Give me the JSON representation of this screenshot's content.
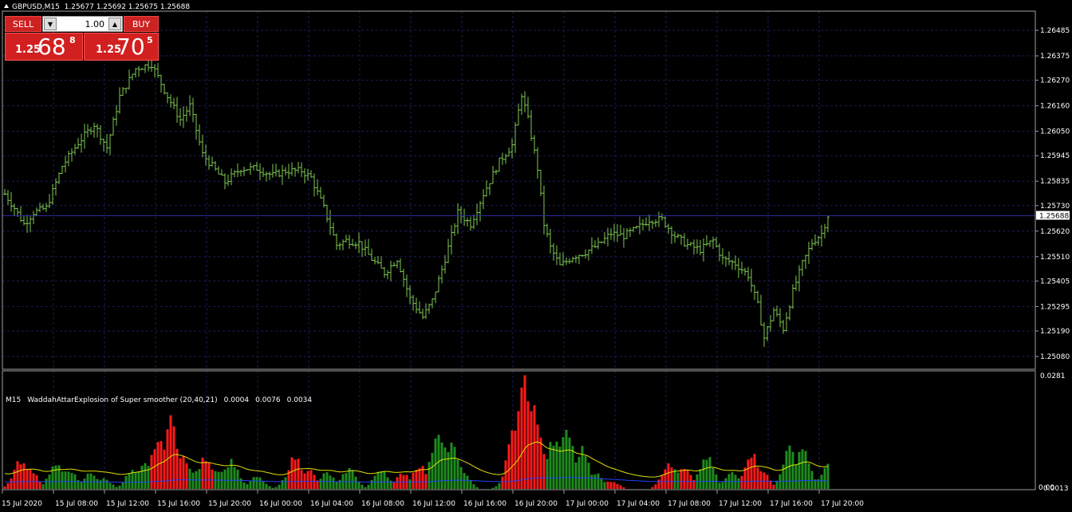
{
  "chart_header": {
    "symbol_tf": "GBPUSD,M15",
    "ohlc": "1.25677 1.25692 1.25675 1.25688"
  },
  "trade_panel": {
    "sell_label": "SELL",
    "buy_label": "BUY",
    "lot_value": "1.00",
    "sell_price_prefix": "1.25",
    "sell_price_big": "68",
    "sell_price_sup": "8",
    "buy_price_prefix": "1.25",
    "buy_price_big": "70",
    "buy_price_sup": "5"
  },
  "price_axis": {
    "labels": [
      "1.26485",
      "1.26375",
      "1.26270",
      "1.26160",
      "1.26050",
      "1.25945",
      "1.25835",
      "1.25730",
      "1.25620",
      "1.25510",
      "1.25405",
      "1.25295",
      "1.25190",
      "1.25080"
    ],
    "current_price": "1.25688"
  },
  "indicator": {
    "timeframe": "M15",
    "name": "WaddahAttarExplosion of Super smoother (20,40,21)",
    "v1": "0.0004",
    "v2": "0.0076",
    "v3": "0.0034",
    "scale_max": "0.0281",
    "scale_min_a": "0.00",
    "scale_min_b": "0.0013"
  },
  "time_axis": {
    "labels": [
      "15 Jul 2020",
      "15 Jul 08:00",
      "15 Jul 12:00",
      "15 Jul 16:00",
      "15 Jul 20:00",
      "16 Jul 00:00",
      "16 Jul 04:00",
      "16 Jul 08:00",
      "16 Jul 12:00",
      "16 Jul 16:00",
      "16 Jul 20:00",
      "17 Jul 00:00",
      "17 Jul 04:00",
      "17 Jul 08:00",
      "17 Jul 12:00",
      "17 Jul 16:00",
      "17 Jul 20:00"
    ]
  },
  "colors": {
    "background": "#000000",
    "grid": "#1c1c5a",
    "bars": "#7ec850",
    "current_price_line": "#2a2a9a",
    "hist_up": "#1e8c1e",
    "hist_down": "#ff1a1a",
    "signal_line": "#e0e000",
    "deadzone_line": "#2040ff"
  },
  "chart_data": {
    "type": "bar",
    "price_series_anchors": [
      [
        0,
        1.2578
      ],
      [
        3,
        1.2572
      ],
      [
        6,
        1.2565
      ],
      [
        9,
        1.257
      ],
      [
        13,
        1.2572
      ],
      [
        18,
        1.259
      ],
      [
        23,
        1.26
      ],
      [
        28,
        1.2608
      ],
      [
        32,
        1.2598
      ],
      [
        36,
        1.262
      ],
      [
        41,
        1.2632
      ],
      [
        46,
        1.2634
      ],
      [
        51,
        1.262
      ],
      [
        55,
        1.261
      ],
      [
        58,
        1.2616
      ],
      [
        62,
        1.2595
      ],
      [
        65,
        1.259
      ],
      [
        69,
        1.2583
      ],
      [
        74,
        1.2589
      ],
      [
        79,
        1.2589
      ],
      [
        84,
        1.2586
      ],
      [
        88,
        1.2588
      ],
      [
        93,
        1.2588
      ],
      [
        96,
        1.2585
      ],
      [
        100,
        1.2572
      ],
      [
        104,
        1.2556
      ],
      [
        107,
        1.2558
      ],
      [
        111,
        1.2557
      ],
      [
        115,
        1.255
      ],
      [
        119,
        1.2544
      ],
      [
        123,
        1.255
      ],
      [
        127,
        1.2533
      ],
      [
        131,
        1.2525
      ],
      [
        134,
        1.2532
      ],
      [
        138,
        1.255
      ],
      [
        142,
        1.257
      ],
      [
        146,
        1.2565
      ],
      [
        150,
        1.2578
      ],
      [
        155,
        1.2592
      ],
      [
        159,
        1.2599
      ],
      [
        162,
        1.2621
      ],
      [
        164,
        1.261
      ],
      [
        167,
        1.2589
      ],
      [
        169,
        1.2565
      ],
      [
        171,
        1.2555
      ],
      [
        174,
        1.2547
      ],
      [
        178,
        1.2551
      ],
      [
        182,
        1.2553
      ],
      [
        186,
        1.2556
      ],
      [
        190,
        1.2561
      ],
      [
        194,
        1.256
      ],
      [
        198,
        1.2563
      ],
      [
        202,
        1.2567
      ],
      [
        206,
        1.2567
      ],
      [
        210,
        1.256
      ],
      [
        214,
        1.2556
      ],
      [
        218,
        1.2554
      ],
      [
        222,
        1.2558
      ],
      [
        225,
        1.255
      ],
      [
        229,
        1.2548
      ],
      [
        233,
        1.2543
      ],
      [
        236,
        1.253
      ],
      [
        238,
        1.2516
      ],
      [
        241,
        1.2528
      ],
      [
        244,
        1.252
      ],
      [
        247,
        1.2536
      ],
      [
        250,
        1.2548
      ],
      [
        253,
        1.2557
      ],
      [
        256,
        1.2561
      ],
      [
        258,
        1.25688
      ]
    ],
    "price_ylim": [
      1.2508,
      1.2654
    ],
    "current_price": 1.25688,
    "histogram_anchors_up": [
      [
        16,
        0.006
      ],
      [
        20,
        0.005
      ],
      [
        27,
        0.004
      ],
      [
        31,
        0.0025
      ],
      [
        40,
        0.0045
      ],
      [
        44,
        0.006
      ],
      [
        49,
        0.0035
      ],
      [
        58,
        0.005
      ],
      [
        62,
        0.006
      ],
      [
        67,
        0.005
      ],
      [
        71,
        0.007
      ],
      [
        79,
        0.003
      ],
      [
        90,
        0.005
      ],
      [
        101,
        0.004
      ],
      [
        108,
        0.005
      ],
      [
        118,
        0.005
      ],
      [
        129,
        0.004
      ],
      [
        136,
        0.015
      ],
      [
        140,
        0.011
      ],
      [
        143,
        0.005
      ],
      [
        158,
        0.0035
      ],
      [
        172,
        0.012
      ],
      [
        176,
        0.015
      ],
      [
        181,
        0.01
      ],
      [
        185,
        0.004
      ],
      [
        210,
        0.005
      ],
      [
        220,
        0.008
      ],
      [
        228,
        0.004
      ],
      [
        246,
        0.01
      ],
      [
        250,
        0.0105
      ],
      [
        258,
        0.006
      ]
    ],
    "histogram_anchors_down": [
      [
        5,
        0.007
      ],
      [
        8,
        0.005
      ],
      [
        48,
        0.012
      ],
      [
        52,
        0.017
      ],
      [
        55,
        0.009
      ],
      [
        63,
        0.008
      ],
      [
        91,
        0.008
      ],
      [
        95,
        0.005
      ],
      [
        125,
        0.004
      ],
      [
        130,
        0.006
      ],
      [
        160,
        0.016
      ],
      [
        163,
        0.0275
      ],
      [
        166,
        0.02
      ],
      [
        190,
        0.002
      ],
      [
        208,
        0.006
      ],
      [
        213,
        0.005
      ],
      [
        234,
        0.009
      ],
      [
        237,
        0.005
      ]
    ],
    "indicator_ylim": [
      0,
      0.0281
    ]
  }
}
